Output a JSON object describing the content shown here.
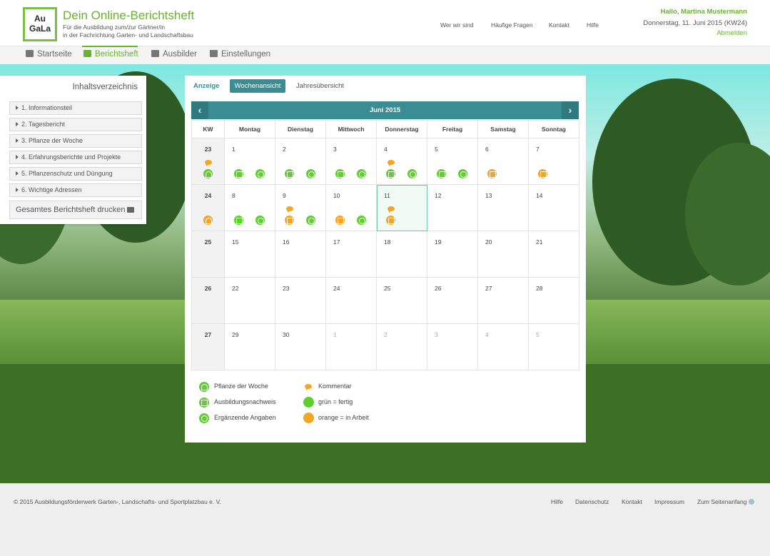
{
  "header": {
    "logo_line1": "Au",
    "logo_line2": "GaLa",
    "title": "Dein Online-Berichtsheft",
    "subtitle1": "Für die Ausbildung zum/zur Gärtner/in",
    "subtitle2": "in der Fachrichtung Garten- und Landschaftsbau",
    "links": [
      "Wer wir sind",
      "Häufige Fragen",
      "Kontakt",
      "Hilfe"
    ],
    "greeting": "Hallo, Martina Mustermann",
    "date": "Donnerstag, 11. Juni 2015 (KW24)",
    "logout": "Abmelden"
  },
  "mainnav": {
    "items": [
      {
        "label": "Startseite",
        "icon": "home-icon"
      },
      {
        "label": "Berichtsheft",
        "icon": "edit-icon"
      },
      {
        "label": "Ausbilder",
        "icon": "users-icon"
      },
      {
        "label": "Einstellungen",
        "icon": "gear-icon"
      }
    ],
    "active": "Berichtsheft"
  },
  "sidebar": {
    "title": "Inhaltsverzeichnis",
    "items": [
      "1. Informationsteil",
      "2. Tagesbericht",
      "3. Pflanze der Woche",
      "4. Erfahrungsberichte und Projekte",
      "5. Pflanzenschutz und Düngung",
      "6. Wichtige Adressen"
    ],
    "print_label": "Gesamtes Berichtsheft drucken"
  },
  "tabs": {
    "label": "Anzeige",
    "week": "Wochenansicht",
    "year": "Jahresübersicht"
  },
  "calendar": {
    "month": "Juni 2015",
    "prev": "‹",
    "next": "›",
    "headers": [
      "KW",
      "Montag",
      "Dienstag",
      "Mittwoch",
      "Donnerstag",
      "Freitag",
      "Samstag",
      "Sonntag"
    ],
    "weeks": [
      {
        "kw": "23",
        "days": [
          "1",
          "2",
          "3",
          "4",
          "5",
          "6",
          "7"
        ]
      },
      {
        "kw": "24",
        "days": [
          "8",
          "9",
          "10",
          "11",
          "12",
          "13",
          "14"
        ]
      },
      {
        "kw": "25",
        "days": [
          "15",
          "16",
          "17",
          "18",
          "19",
          "20",
          "21"
        ]
      },
      {
        "kw": "26",
        "days": [
          "22",
          "23",
          "24",
          "25",
          "26",
          "27",
          "28"
        ]
      },
      {
        "kw": "27",
        "days": [
          "29",
          "30",
          "1",
          "2",
          "3",
          "4",
          "5"
        ]
      }
    ]
  },
  "legend": {
    "plant": "Pflanze der Woche",
    "proof": "Ausbildungsnachweis",
    "extra": "Ergänzende Angaben",
    "comment": "Kommentar",
    "green": "grün = fertig",
    "orange": "orange = in Arbeit"
  },
  "colors": {
    "brand_green": "#6bb132",
    "teal": "#3a8d92",
    "status_green": "#5fcf2e",
    "status_orange": "#f2a623"
  },
  "footer": {
    "copyright": "© 2015 Ausbildungsförderwerk Garten-, Landschafts- und Sportplatzbau e. V.",
    "links": [
      "Hilfe",
      "Datenschutz",
      "Kontakt",
      "Impressum",
      "Zum Seitenanfang"
    ]
  }
}
